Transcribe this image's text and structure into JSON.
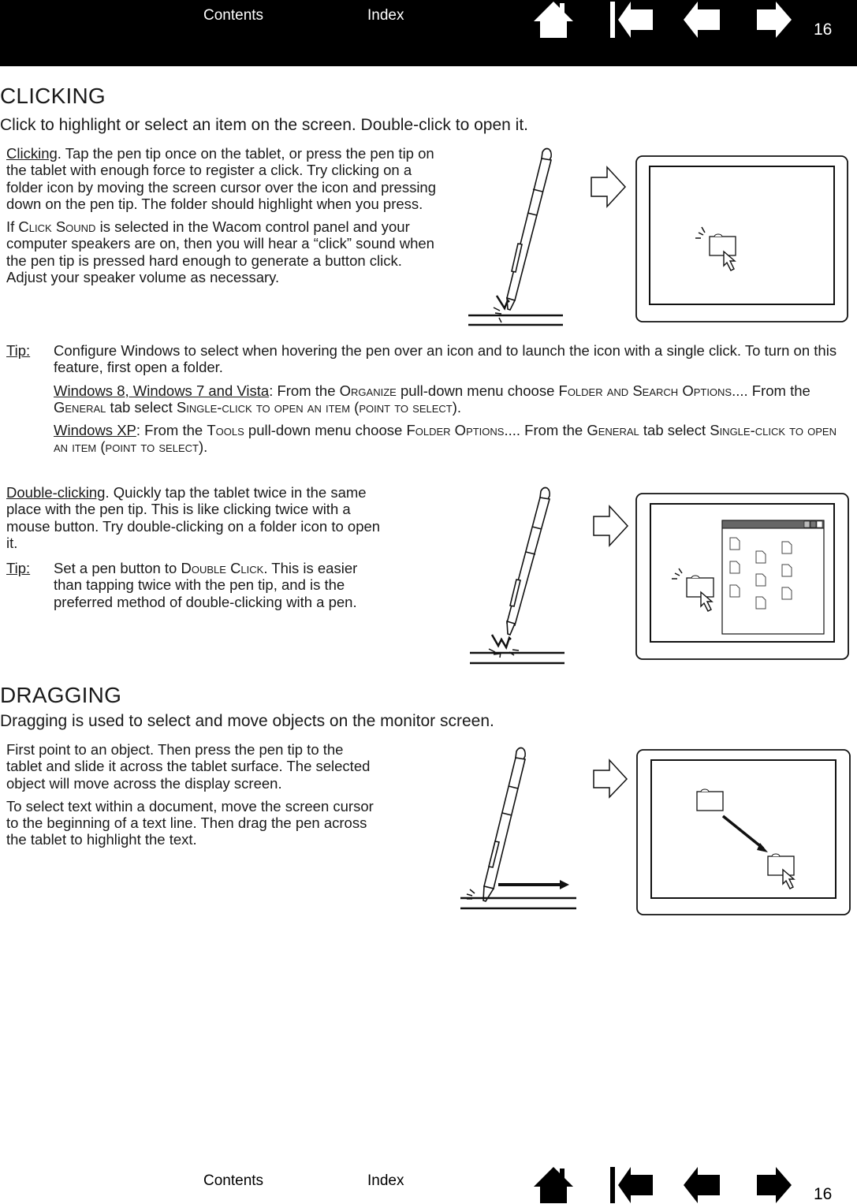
{
  "nav": {
    "contents_label": "Contents",
    "index_label": "Index",
    "page_number": "16",
    "icons": [
      "home-icon",
      "first-page-icon",
      "previous-page-icon",
      "next-page-icon"
    ]
  },
  "clicking": {
    "heading": "CLICKING",
    "lead": "Click to highlight or select an item on the screen. Double-click to open it.",
    "para1_term": "Clicking",
    "para1_text": ". Tap the pen tip once on the tablet, or press the pen tip on the tablet with enough force to register a click. Try clicking on a folder icon by moving the screen cursor over the icon and pressing down on the pen tip. The folder should highlight when you press.",
    "para2_pre": "If ",
    "para2_sc": "Click Sound",
    "para2_text": " is selected in the Wacom control panel and your computer speakers are on, then you will hear a “click” sound when the pen tip is pressed hard enough to generate a button click. Adjust your speaker volume as necessary."
  },
  "tip1": {
    "label": "Tip:",
    "line1": "Configure Windows to select when hovering the pen over an icon and to launch the icon with a single click. To turn on this feature, first open a folder.",
    "win7_link": "Windows 8, Windows 7 and Vista",
    "win7_a": ": From the ",
    "win7_organize": "Organize",
    "win7_b": " pull-down menu choose ",
    "win7_folder": "Folder and Search Options....",
    "win7_c": " From the ",
    "win7_general": "General",
    "win7_d": " tab select ",
    "win7_single": "Single-click to open an item (point to select)",
    "win7_e": ".",
    "xp_link": "Windows XP",
    "xp_a": ": From the ",
    "xp_tools": "Tools",
    "xp_b": " pull-down menu choose ",
    "xp_folder": "Folder Options....",
    "xp_c": " From the ",
    "xp_general": "General",
    "xp_d": " tab select ",
    "xp_single": "Single-click to open an item (point to select)",
    "xp_e": "."
  },
  "double_clicking": {
    "term": "Double-clicking",
    "text": ". Quickly tap the tablet twice in the same place with the pen tip. This is like clicking twice with a mouse button. Try double-clicking on a folder icon to open it.",
    "tip_label": "Tip:",
    "tip_pre": "Set a pen button to ",
    "tip_sc": "Double Click",
    "tip_text": ". This is easier than tapping twice with the pen tip, and is the preferred method of double-clicking with a pen."
  },
  "dragging": {
    "heading": "DRAGGING",
    "lead": "Dragging is used to select and move objects on the monitor screen.",
    "para1": "First point to an object. Then press the pen tip to the tablet and slide it across the tablet surface. The selected object will move across the display screen.",
    "para2": "To select text within a document, move the screen cursor to the beginning of a text line. Then drag the pen across the tablet to highlight the text."
  },
  "illustrations": {
    "clicking": [
      "pen-icon",
      "arrow-right-icon",
      "display-screen",
      "folder-icon",
      "cursor-icon"
    ],
    "double_clicking": [
      "pen-icon",
      "arrow-right-icon",
      "display-screen",
      "open-window",
      "file-icons",
      "folder-icon",
      "cursor-icon"
    ],
    "dragging": [
      "pen-icon",
      "drag-arrow-icon",
      "arrow-right-icon",
      "display-screen",
      "folder-icon",
      "cursor-icon"
    ]
  }
}
